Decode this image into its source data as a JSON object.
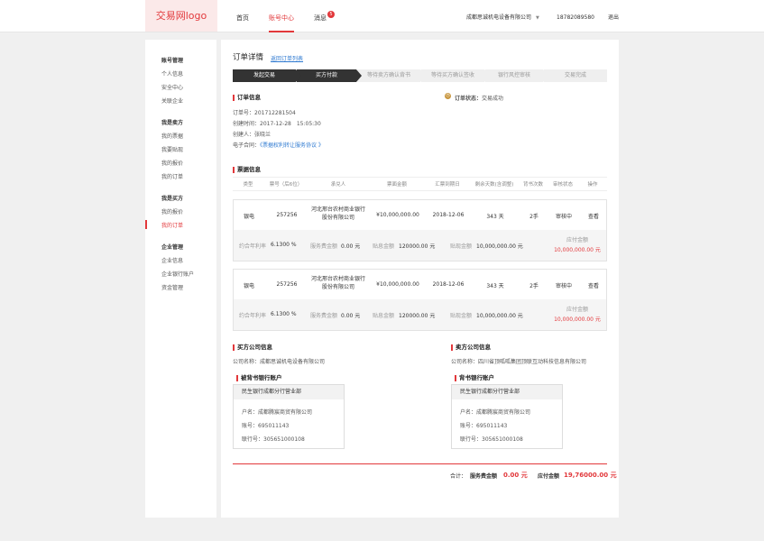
{
  "header": {
    "logo": "交易网logo",
    "nav": {
      "home": "首页",
      "account": "账号中心",
      "messages": "消息",
      "badge": "5"
    },
    "company": "成都思诚机电设备有限公司",
    "phone": "18782089580",
    "logout": "退出"
  },
  "sidebar": {
    "sections": [
      {
        "title": "账号管理",
        "items": [
          "个人信息",
          "安全中心",
          "关联企业"
        ]
      },
      {
        "title": "我是卖方",
        "items": [
          "我的票据",
          "我要贴现",
          "我的报价",
          "我的订单"
        ]
      },
      {
        "title": "我是买方",
        "items": [
          "我的报价",
          "我的订单"
        ]
      },
      {
        "title": "企业管理",
        "items": [
          "企业信息",
          "企业银行账户",
          "资金管理"
        ]
      }
    ],
    "active": "我的订单"
  },
  "order": {
    "title": "订单详情",
    "back_link": "返回订单列表",
    "steps": [
      "发起交易",
      "买方付款",
      "等待卖方确认背书",
      "等待买方确认签收",
      "银行风控审核",
      "交易完成"
    ],
    "info_title": "订单信息",
    "order_no": "订单号：201712281504",
    "created": "创建时间：2017-12-28　15:05:30",
    "creator": "创建人：张晓兰",
    "contract_label": "电子合同：",
    "contract_link": "《票据权利转让服务协议 》",
    "status_label": "订单状态：",
    "status_value": "交易成功"
  },
  "bills": {
    "title": "票据信息",
    "columns": [
      "类型",
      "票号（后6位）",
      "承兑人",
      "票面金额",
      "汇票到期日",
      "剩余天数(含调整)",
      "背书次数",
      "审核状态",
      "操作"
    ],
    "rows": [
      {
        "type": "银电",
        "no": "257256",
        "acceptor": "河北邢台农村商业银行股份有限公司",
        "amount": "¥10,000,000.00",
        "due": "2018-12-06",
        "days": "343 天",
        "endorse": "2手",
        "review": "审核中",
        "action": "查看",
        "rate_label": "约合年利率",
        "rate": "6.1300 %",
        "fee_label": "服务费金额",
        "fee": "0.00 元",
        "interest_label": "贴息金额",
        "interest": "120000.00 元",
        "discount_label": "贴现金额",
        "discount": "10,000,000.00 元",
        "pay_label": "应付金额",
        "pay": "10,000,000.00 元"
      },
      {
        "type": "银电",
        "no": "257256",
        "acceptor": "河北邢台农村商业银行股份有限公司",
        "amount": "¥10,000,000.00",
        "due": "2018-12-06",
        "days": "343 天",
        "endorse": "2手",
        "review": "审核中",
        "action": "查看",
        "rate_label": "约合年利率",
        "rate": "6.1300 %",
        "fee_label": "服务费金额",
        "fee": "0.00 元",
        "interest_label": "贴息金额",
        "interest": "120000.00 元",
        "discount_label": "贴现金额",
        "discount": "10,000,000.00 元",
        "pay_label": "应付金额",
        "pay": "10,000,000.00 元"
      }
    ]
  },
  "buyer": {
    "title": "买方公司信息",
    "company": "公司名称：成都思诚机电设备有限公司",
    "bank_title": "被背书银行账户",
    "bank_name": "民生银行成都分行营业部",
    "holder": "户名：成都腾宸商贸有限公司",
    "account": "账号：695011143",
    "bank_no": "联行号：305651000108"
  },
  "seller": {
    "title": "卖方公司信息",
    "company": "公司名称：四川省顶呱呱集团顶联互动科技信息有限公司",
    "bank_title": "背书银行账户",
    "bank_name": "民生银行成都分行营业部",
    "holder": "户名：成都腾宸商贸有限公司",
    "account": "账号：695011143",
    "bank_no": "联行号：305651000108"
  },
  "summary": {
    "total_label": "合计：",
    "fee_label": "服务费金额",
    "fee": "0.00 元",
    "pay_label": "应付金额",
    "pay": "19,76000.00 元"
  }
}
